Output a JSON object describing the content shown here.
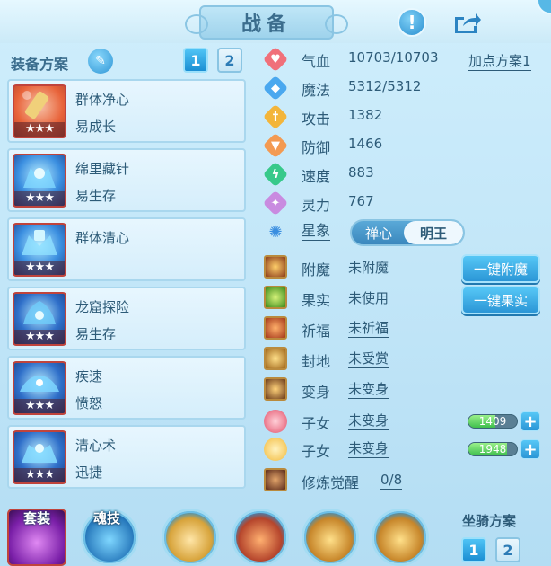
{
  "header": {
    "title": "战备"
  },
  "equipment": {
    "section_title": "装备方案",
    "plan_buttons": [
      "1",
      "2"
    ],
    "active_plan": "1",
    "items": [
      {
        "name": "群体净心",
        "trait": "易成长",
        "stars": "★★★",
        "colors": [
          "#f48a4b",
          "#f0c0a8"
        ]
      },
      {
        "name": "绵里藏针",
        "trait": "易生存",
        "stars": "★★★",
        "colors": [
          "#3a7fd6",
          "#9fe3ff"
        ]
      },
      {
        "name": "群体清心",
        "trait": "",
        "stars": "★★★",
        "colors": [
          "#3a7fd6",
          "#9fe3ff"
        ]
      },
      {
        "name": "龙窟探险",
        "trait": "易生存",
        "stars": "★★★",
        "colors": [
          "#2f6fc9",
          "#8fd6fb"
        ]
      },
      {
        "name": "疾速",
        "trait": "愤怒",
        "stars": "★★★",
        "colors": [
          "#2f6fc9",
          "#8fd6fb"
        ]
      },
      {
        "name": "清心术",
        "trait": "迅捷",
        "stars": "★★★",
        "colors": [
          "#2f6fc9",
          "#8fd6fb"
        ]
      }
    ]
  },
  "stats": {
    "plan_link": "加点方案1",
    "rows": [
      {
        "label": "气血",
        "value": "10703/10703",
        "color": "#f0707a"
      },
      {
        "label": "魔法",
        "value": "5312/5312",
        "color": "#4aa8ef"
      },
      {
        "label": "攻击",
        "value": "1382",
        "color": "#f3b53a"
      },
      {
        "label": "防御",
        "value": "1466",
        "color": "#f39a52"
      },
      {
        "label": "速度",
        "value": "883",
        "color": "#37c98a"
      },
      {
        "label": "灵力",
        "value": "767",
        "color": "#c98be0"
      }
    ],
    "star": {
      "label": "星象",
      "options": [
        "禅心",
        "明王"
      ],
      "selected": "明王"
    }
  },
  "extras": {
    "enchant": {
      "label": "附魔",
      "value": "未附魔",
      "button": "一键附魔"
    },
    "fruit": {
      "label": "果实",
      "value": "未使用",
      "button": "一键果实"
    },
    "bless": {
      "label": "祈福",
      "value": "未祈福"
    },
    "land": {
      "label": "封地",
      "value": "未受赏"
    },
    "transform": {
      "label": "变身",
      "value": "未变身"
    },
    "child1": {
      "label": "子女",
      "value": "未变身",
      "bar_value": "1409",
      "bar_fraction": 0.55
    },
    "child2": {
      "label": "子女",
      "value": "未变身",
      "bar_value": "1948",
      "bar_fraction": 0.8
    },
    "cultivation": {
      "label": "修炼觉醒",
      "value": "0/8"
    }
  },
  "bottom": {
    "set_label": "套装",
    "soul_label": "魂技",
    "mount_label": "坐骑方案",
    "mount_buttons": [
      "1",
      "2"
    ]
  }
}
